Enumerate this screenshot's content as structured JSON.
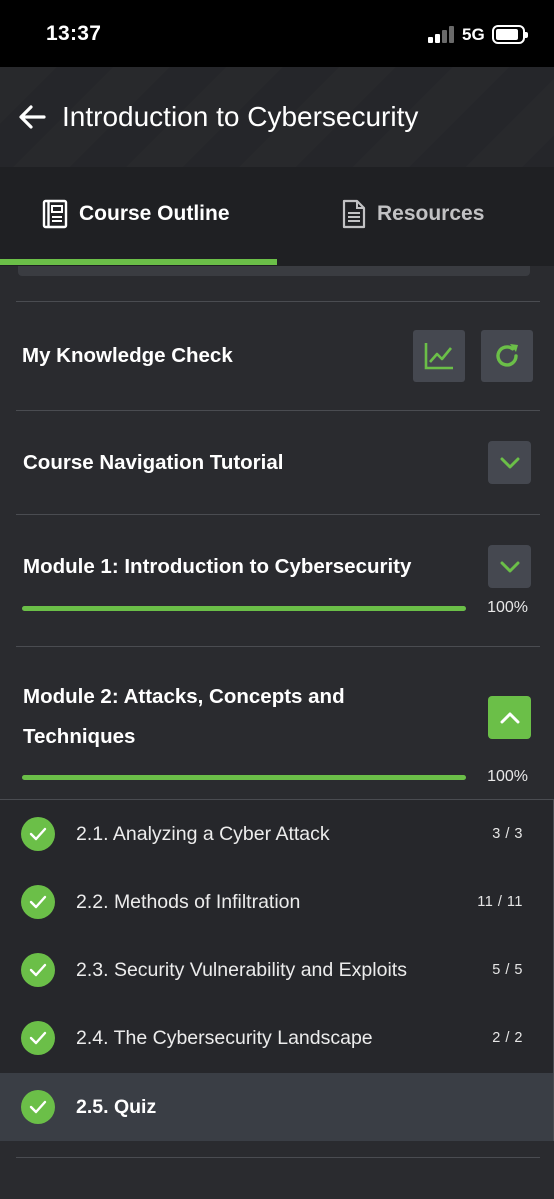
{
  "status_bar": {
    "time": "13:37",
    "network": "5G"
  },
  "header": {
    "title": "Introduction to Cybersecurity"
  },
  "tabs": [
    {
      "label": "Course Outline",
      "icon": "book-icon",
      "active": true
    },
    {
      "label": "Resources",
      "icon": "document-icon",
      "active": false
    }
  ],
  "knowledge_check": {
    "title": "My Knowledge Check"
  },
  "sections": [
    {
      "title": "Course Navigation Tutorial",
      "expanded": false
    },
    {
      "title": "Module 1: Introduction to Cybersecurity",
      "expanded": false,
      "progress_label": "100%",
      "progress": 1.0
    },
    {
      "title_line1": "Module 2: Attacks, Concepts and",
      "title_line2": "Techniques",
      "expanded": true,
      "progress_label": "100%",
      "progress": 1.0
    }
  ],
  "lessons": [
    {
      "title": "2.1. Analyzing a Cyber Attack",
      "count": "3 / 3"
    },
    {
      "title": "2.2. Methods of Infiltration",
      "count": "11 / 11"
    },
    {
      "title": "2.3. Security Vulnerability and Exploits",
      "count": "5 / 5"
    },
    {
      "title": "2.4. The Cybersecurity Landscape",
      "count": "2 / 2"
    },
    {
      "title": "2.5. Quiz",
      "count": ""
    }
  ],
  "colors": {
    "accent": "#6bbf48",
    "background": "#2a2b2f",
    "button": "#454850"
  }
}
